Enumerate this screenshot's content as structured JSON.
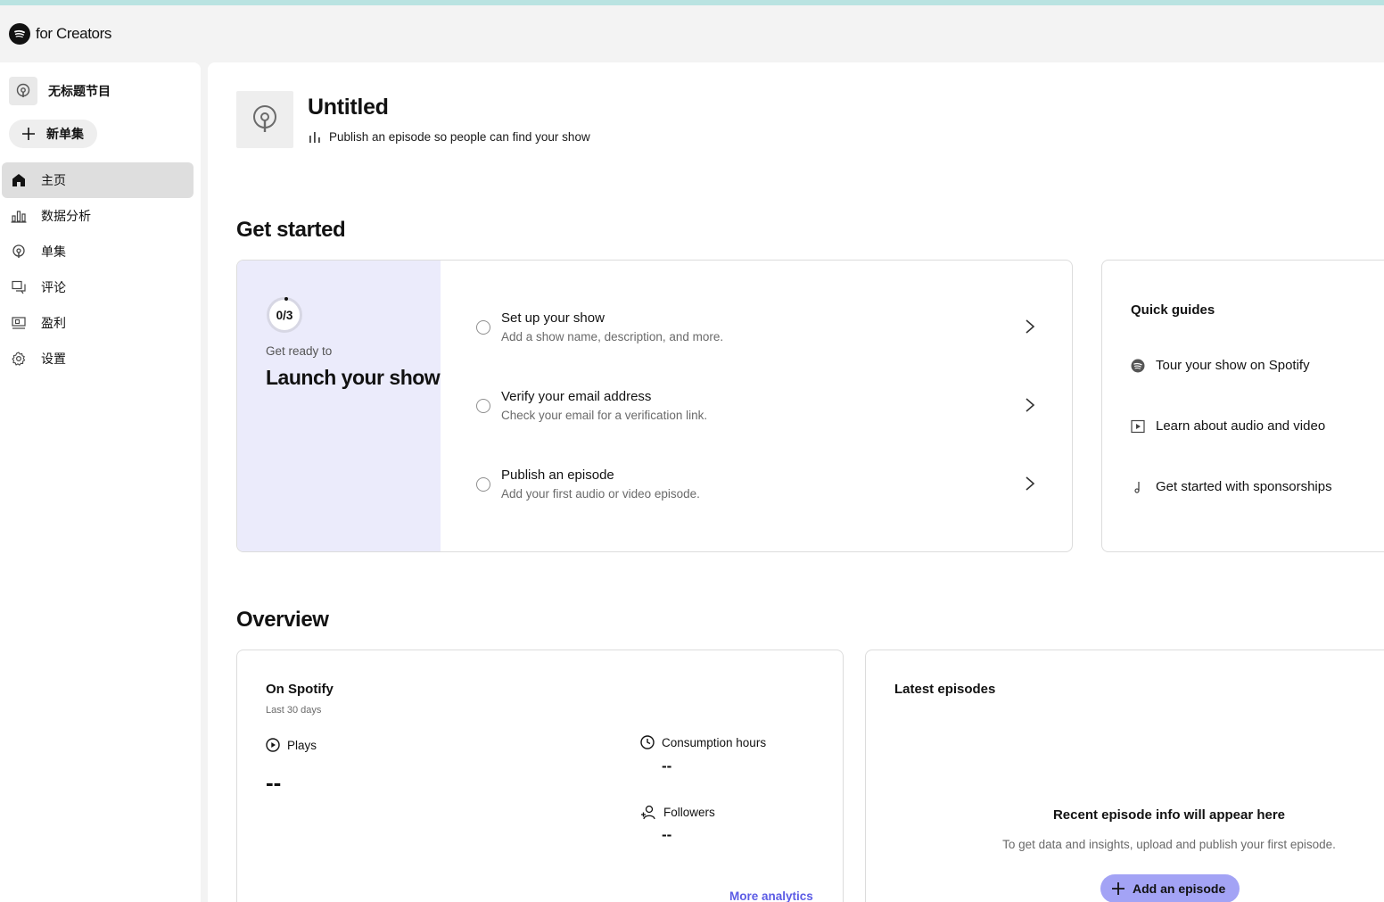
{
  "app": {
    "brand": "for Creators"
  },
  "sidebar": {
    "show_name": "无标题节目",
    "new_episode_label": "新单集",
    "nav": [
      {
        "label": "主页",
        "icon": "home-icon",
        "active": true
      },
      {
        "label": "数据分析",
        "icon": "bar-chart-icon",
        "active": false
      },
      {
        "label": "单集",
        "icon": "podcast-icon",
        "active": false
      },
      {
        "label": "评论",
        "icon": "comments-icon",
        "active": false
      },
      {
        "label": "盈利",
        "icon": "monetize-icon",
        "active": false
      },
      {
        "label": "设置",
        "icon": "gear-icon",
        "active": false
      }
    ]
  },
  "header": {
    "title": "Untitled",
    "subtitle": "Publish an episode so people can find your show"
  },
  "get_started": {
    "section_title": "Get started",
    "progress": "0/3",
    "ready_label": "Get ready to",
    "launch_title": "Launch your show",
    "tasks": [
      {
        "title": "Set up your show",
        "desc": "Add a show name, description, and more."
      },
      {
        "title": "Verify your email address",
        "desc": "Check your email for a verification link."
      },
      {
        "title": "Publish an episode",
        "desc": "Add your first audio or video episode."
      }
    ]
  },
  "quick_guides": {
    "title": "Quick guides",
    "items": [
      {
        "label": "Tour your show on Spotify",
        "icon": "spotify-icon"
      },
      {
        "label": "Learn about audio and video",
        "icon": "play-box-icon"
      },
      {
        "label": "Get started with sponsorships",
        "icon": "sponsorship-icon"
      }
    ]
  },
  "overview": {
    "section_title": "Overview",
    "on_spotify": {
      "title": "On Spotify",
      "period": "Last 30 days",
      "plays_label": "Plays",
      "plays_value": "--",
      "hours_label": "Consumption hours",
      "hours_value": "--",
      "followers_label": "Followers",
      "followers_value": "--",
      "more_link": "More analytics"
    },
    "latest": {
      "title": "Latest episodes",
      "empty_title": "Recent episode info will appear here",
      "empty_desc": "To get data and insights, upload and publish your first episode.",
      "add_button": "Add an episode"
    }
  },
  "colors": {
    "accent": "#a3a3f5",
    "link": "#5c5ce5",
    "launch_panel": "#ebebfb"
  }
}
